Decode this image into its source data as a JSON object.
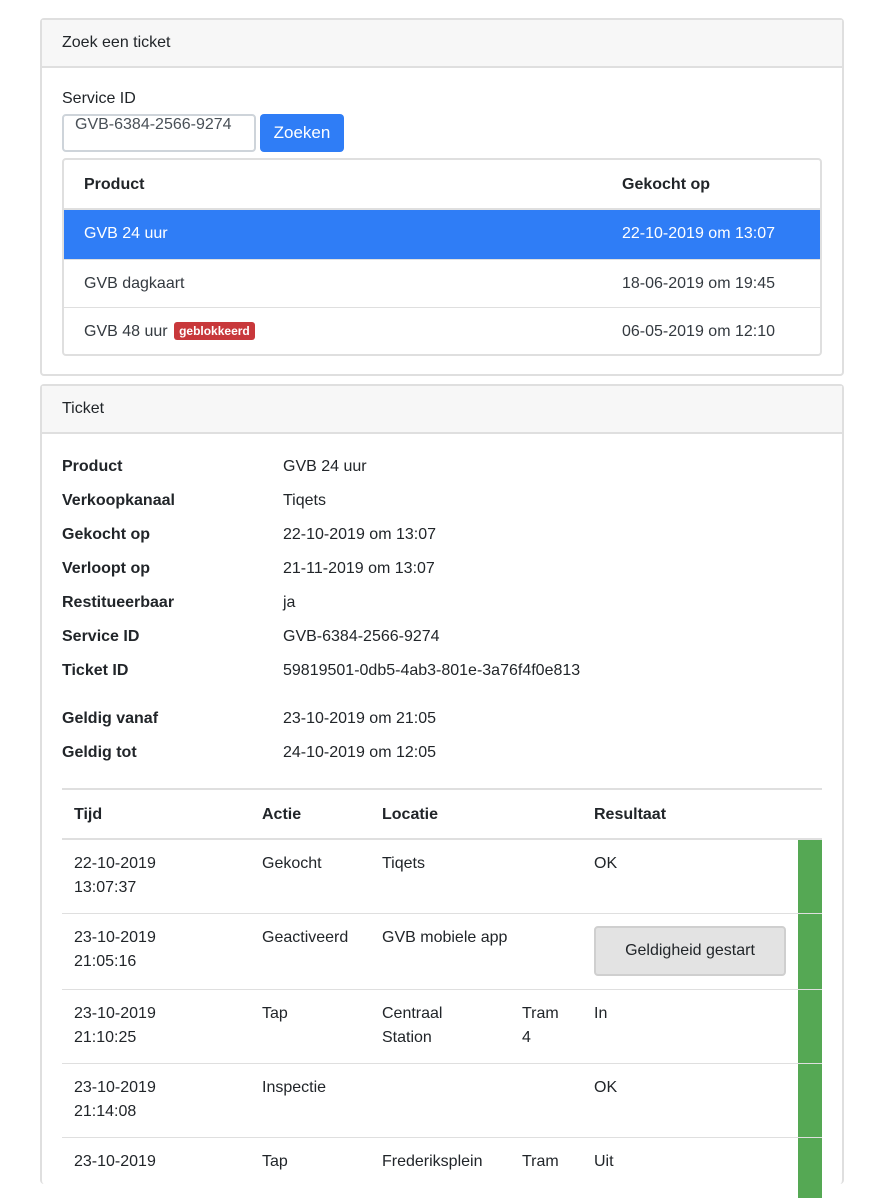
{
  "search": {
    "header": "Zoek een ticket",
    "label": "Service ID",
    "input_value": "GVB-6384-2566-9274",
    "button_label": "Zoeken",
    "table": {
      "columns": [
        "Product",
        "Gekocht op"
      ],
      "rows": [
        {
          "product": "GVB 24 uur",
          "date": "22-10-2019 om 13:07",
          "badge": ""
        },
        {
          "product": "GVB dagkaart",
          "date": "18-06-2019 om 19:45",
          "badge": ""
        },
        {
          "product": "GVB 48 uur",
          "date": "06-05-2019 om 12:10",
          "badge": "geblokkeerd"
        }
      ]
    }
  },
  "ticket": {
    "header": "Ticket",
    "details": [
      {
        "label": "Product",
        "value": "GVB 24 uur"
      },
      {
        "label": "Verkoopkanaal",
        "value": "Tiqets"
      },
      {
        "label": "Gekocht op",
        "value": "22-10-2019 om 13:07"
      },
      {
        "label": "Verloopt op",
        "value": "21-11-2019 om 13:07"
      },
      {
        "label": "Restitueerbaar",
        "value": "ja"
      },
      {
        "label": "Service ID",
        "value": "GVB-6384-2566-9274"
      },
      {
        "label": "Ticket ID",
        "value": "59819501-0db5-4ab3-801e-3a76f4f0e813"
      },
      {
        "label": "Geldig vanaf",
        "value": "23-10-2019 om 21:05"
      },
      {
        "label": "Geldig tot",
        "value": "24-10-2019 om 12:05"
      }
    ],
    "events": {
      "columns": [
        "Tijd",
        "Actie",
        "Locatie",
        "Resultaat"
      ],
      "rows": [
        {
          "date": "22-10-2019",
          "time": "13:07:37",
          "action": "Gekocht",
          "loc1": "Tiqets",
          "loc2": "",
          "vehicle1": "",
          "vehicle2": "",
          "result": "OK"
        },
        {
          "date": "23-10-2019",
          "time": "21:05:16",
          "action": "Geactiveerd",
          "loc1": "GVB mobiele app",
          "loc2": "",
          "vehicle1": "",
          "vehicle2": "",
          "result": "Geldigheid gestart"
        },
        {
          "date": "23-10-2019",
          "time": "21:10:25",
          "action": "Tap",
          "loc1": "Centraal",
          "loc2": "Station",
          "vehicle1": "Tram",
          "vehicle2": "4",
          "result": "In"
        },
        {
          "date": "23-10-2019",
          "time": "21:14:08",
          "action": "Inspectie",
          "loc1": "",
          "loc2": "",
          "vehicle1": "",
          "vehicle2": "",
          "result": "OK"
        },
        {
          "date": "23-10-2019",
          "time": "",
          "action": "Tap",
          "loc1": "Frederiksplein",
          "loc2": "",
          "vehicle1": "Tram",
          "vehicle2": "",
          "result": "Uit"
        }
      ],
      "status_color": "#55a854"
    }
  },
  "colors": {
    "accent": "#2f7df6",
    "danger": "#c8383b",
    "success": "#55a854"
  }
}
